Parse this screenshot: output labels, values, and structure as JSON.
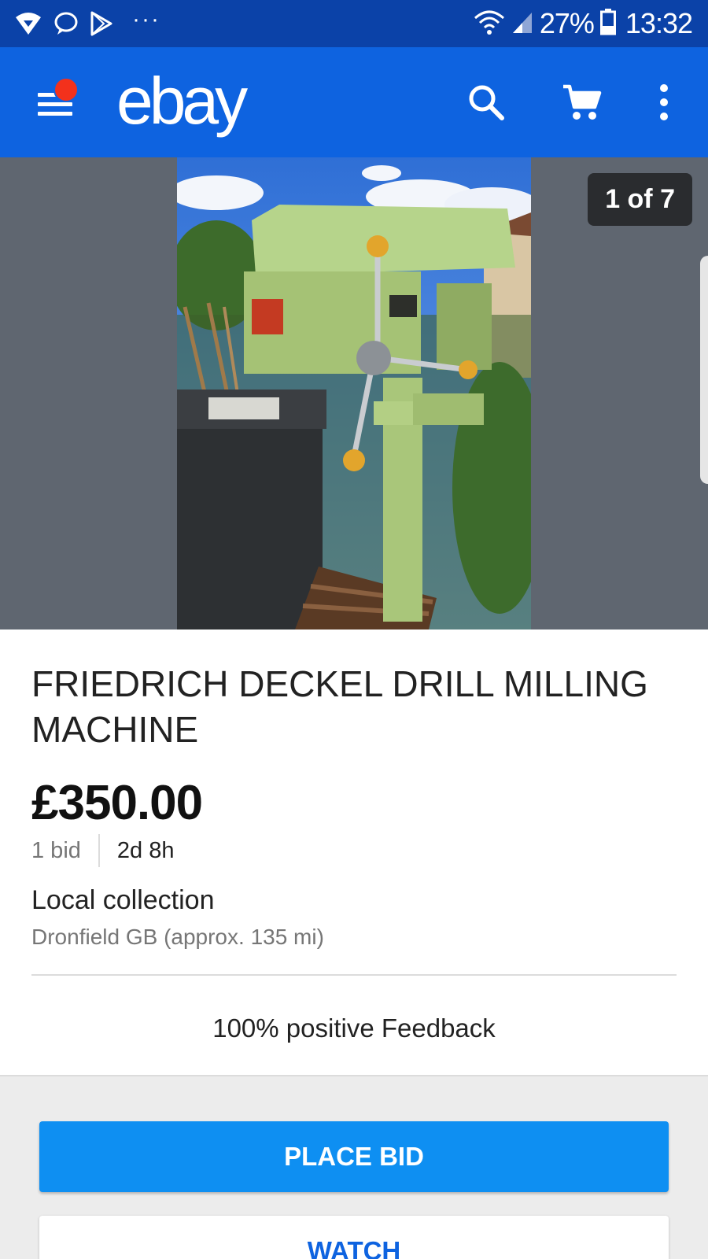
{
  "status_bar": {
    "icons_left": [
      "wifi-shield-icon",
      "chat-bubble-icon",
      "play-store-icon",
      "more-dots-icon"
    ],
    "more": "···",
    "icons_right": [
      "wifi-signal-icon",
      "cell-signal-icon",
      "battery-icon"
    ],
    "battery": "27%",
    "time": "13:32"
  },
  "app_bar": {
    "logo": "ebay",
    "menu_icon": "hamburger-menu-icon",
    "notification_dot_color": "#f3311c",
    "actions": [
      "search-icon",
      "cart-icon",
      "overflow-menu-icon"
    ],
    "color": "#0e63e0"
  },
  "gallery": {
    "counter": "1 of 7",
    "image_subject": "green-drill-press-photo"
  },
  "listing": {
    "title": "FRIEDRICH DECKEL DRILL MILLING MACHINE",
    "price": "£350.00",
    "bids": "1 bid",
    "time_left": "2d 8h",
    "delivery": "Local collection",
    "location": "Dronfield GB (approx. 135 mi)",
    "feedback": "100% positive Feedback"
  },
  "actions": {
    "place_bid": "PLACE BID",
    "watch": "WATCH",
    "primary_color": "#0e8ff2"
  }
}
